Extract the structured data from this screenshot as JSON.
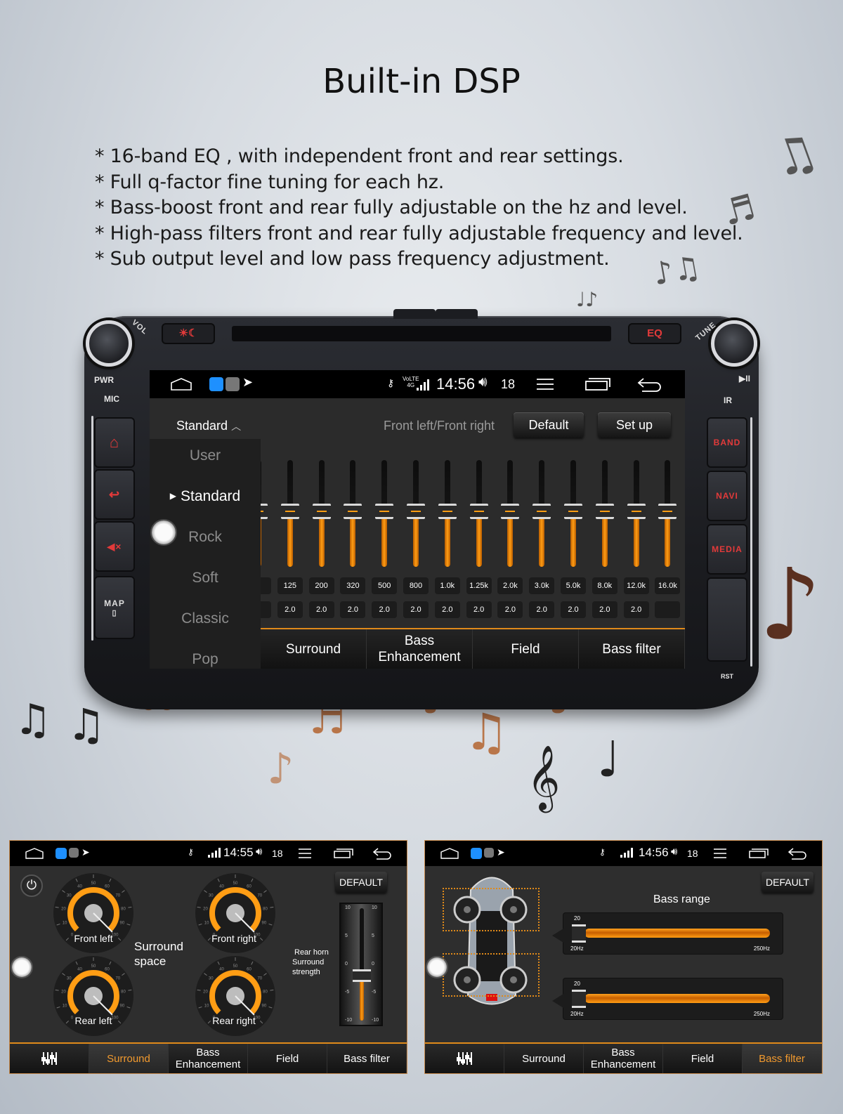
{
  "page": {
    "title": "Built-in DSP",
    "features": [
      "* 16-band EQ , with independent front and rear settings.",
      "* Full q-factor fine tuning for each hz.",
      "* Bass-boost front and rear fully adjustable on the hz and level.",
      "* High-pass filters front and rear fully adjustable frequency and level.",
      "* Sub output level and  low pass frequency adjustment."
    ]
  },
  "head_unit": {
    "knob_left_label": "VOL",
    "knob_right_label": "TUNE",
    "pwr_label": "PWR",
    "mic_label": "MIC",
    "ir_label": "IR",
    "rst_label": "RST",
    "play_pause_label": "▶II",
    "top_left_button_icon": "day-night-icon",
    "top_right_button_label": "EQ",
    "left_buttons": [
      {
        "icon": "home-icon",
        "glyph": "⌂"
      },
      {
        "icon": "back-icon",
        "glyph": "↩"
      },
      {
        "icon": "mute-icon",
        "glyph": "🔇"
      },
      {
        "label": "MAP",
        "icon": "sd-card-icon",
        "glyph": "▯"
      }
    ],
    "right_buttons": [
      "BAND",
      "NAVI",
      "MEDIA",
      ""
    ]
  },
  "main_screen": {
    "status": {
      "time": "14:56",
      "volume": "18",
      "network": "4G",
      "volte": "VoLTE"
    },
    "preset_toggle": "Standard",
    "channel_label": "Front left/Front right",
    "default_button": "Default",
    "setup_button": "Set up",
    "presets": [
      {
        "label": "User",
        "selected": false
      },
      {
        "label": "Standard",
        "selected": true
      },
      {
        "label": "Rock",
        "selected": false
      },
      {
        "label": "Soft",
        "selected": false
      },
      {
        "label": "Classic",
        "selected": false
      },
      {
        "label": "Pop",
        "selected": false
      }
    ],
    "eq_bands": [
      {
        "freq": "",
        "q": "",
        "level": 0
      },
      {
        "freq": "125",
        "q": "2.0",
        "level": 0
      },
      {
        "freq": "200",
        "q": "2.0",
        "level": 0
      },
      {
        "freq": "320",
        "q": "2.0",
        "level": 0
      },
      {
        "freq": "500",
        "q": "2.0",
        "level": 0
      },
      {
        "freq": "800",
        "q": "2.0",
        "level": 0
      },
      {
        "freq": "1.0k",
        "q": "2.0",
        "level": 0
      },
      {
        "freq": "1.25k",
        "q": "2.0",
        "level": 0
      },
      {
        "freq": "2.0k",
        "q": "2.0",
        "level": 0
      },
      {
        "freq": "3.0k",
        "q": "2.0",
        "level": 0
      },
      {
        "freq": "5.0k",
        "q": "2.0",
        "level": 0
      },
      {
        "freq": "8.0k",
        "q": "2.0",
        "level": 0
      },
      {
        "freq": "12.0k",
        "q": "2.0",
        "level": 0
      },
      {
        "freq": "16.0k",
        "q": "",
        "level": 0
      }
    ],
    "eq_level_fraction": 0.48,
    "tabs": [
      "Surround",
      "Bass\nEnhancement",
      "Field",
      "Bass filter"
    ]
  },
  "surround_screen": {
    "status": {
      "time": "14:55",
      "volume": "18"
    },
    "default_button": "DEFAULT",
    "dials": [
      {
        "label": "Front left",
        "value": 100
      },
      {
        "label": "Front right",
        "value": 100
      },
      {
        "label": "Rear left",
        "value": 100
      },
      {
        "label": "Rear right",
        "value": 100
      }
    ],
    "dial_ticks": [
      "0",
      "10",
      "20",
      "30",
      "40",
      "50",
      "60",
      "70",
      "80",
      "90",
      "100"
    ],
    "center_label_line1": "Surround",
    "center_label_line2": "space",
    "rear_label_line1": "Rear horn",
    "rear_label_line2": "Surround",
    "rear_label_line3": "strength",
    "rear_strength": {
      "value": -2,
      "min": -10,
      "max": 10,
      "ticks": [
        "10",
        "5",
        "0",
        "-5",
        "-10"
      ]
    },
    "tabs": [
      {
        "label": "",
        "icon": "equalizer-icon",
        "active": false
      },
      {
        "label": "Surround",
        "active": true
      },
      {
        "label": "Bass\nEnhancement",
        "active": false
      },
      {
        "label": "Field",
        "active": false
      },
      {
        "label": "Bass filter",
        "active": false
      }
    ]
  },
  "bass_screen": {
    "status": {
      "time": "14:56",
      "volume": "18"
    },
    "default_button": "DEFAULT",
    "title": "Bass range",
    "sliders": [
      {
        "value": 20,
        "min_label": "20Hz",
        "max_label": "250Hz",
        "min": 20,
        "max": 250
      },
      {
        "value": 20,
        "min_label": "20Hz",
        "max_label": "250Hz",
        "min": 20,
        "max": 250
      }
    ],
    "tabs": [
      {
        "label": "",
        "icon": "equalizer-icon",
        "active": false
      },
      {
        "label": "Surround",
        "active": false
      },
      {
        "label": "Bass\nEnhancement",
        "active": false
      },
      {
        "label": "Field",
        "active": false
      },
      {
        "label": "Bass filter",
        "active": true
      }
    ]
  },
  "colors": {
    "accent": "#ff9d14",
    "button_red": "#e23a3a",
    "active_tab": "#f29a2e"
  }
}
